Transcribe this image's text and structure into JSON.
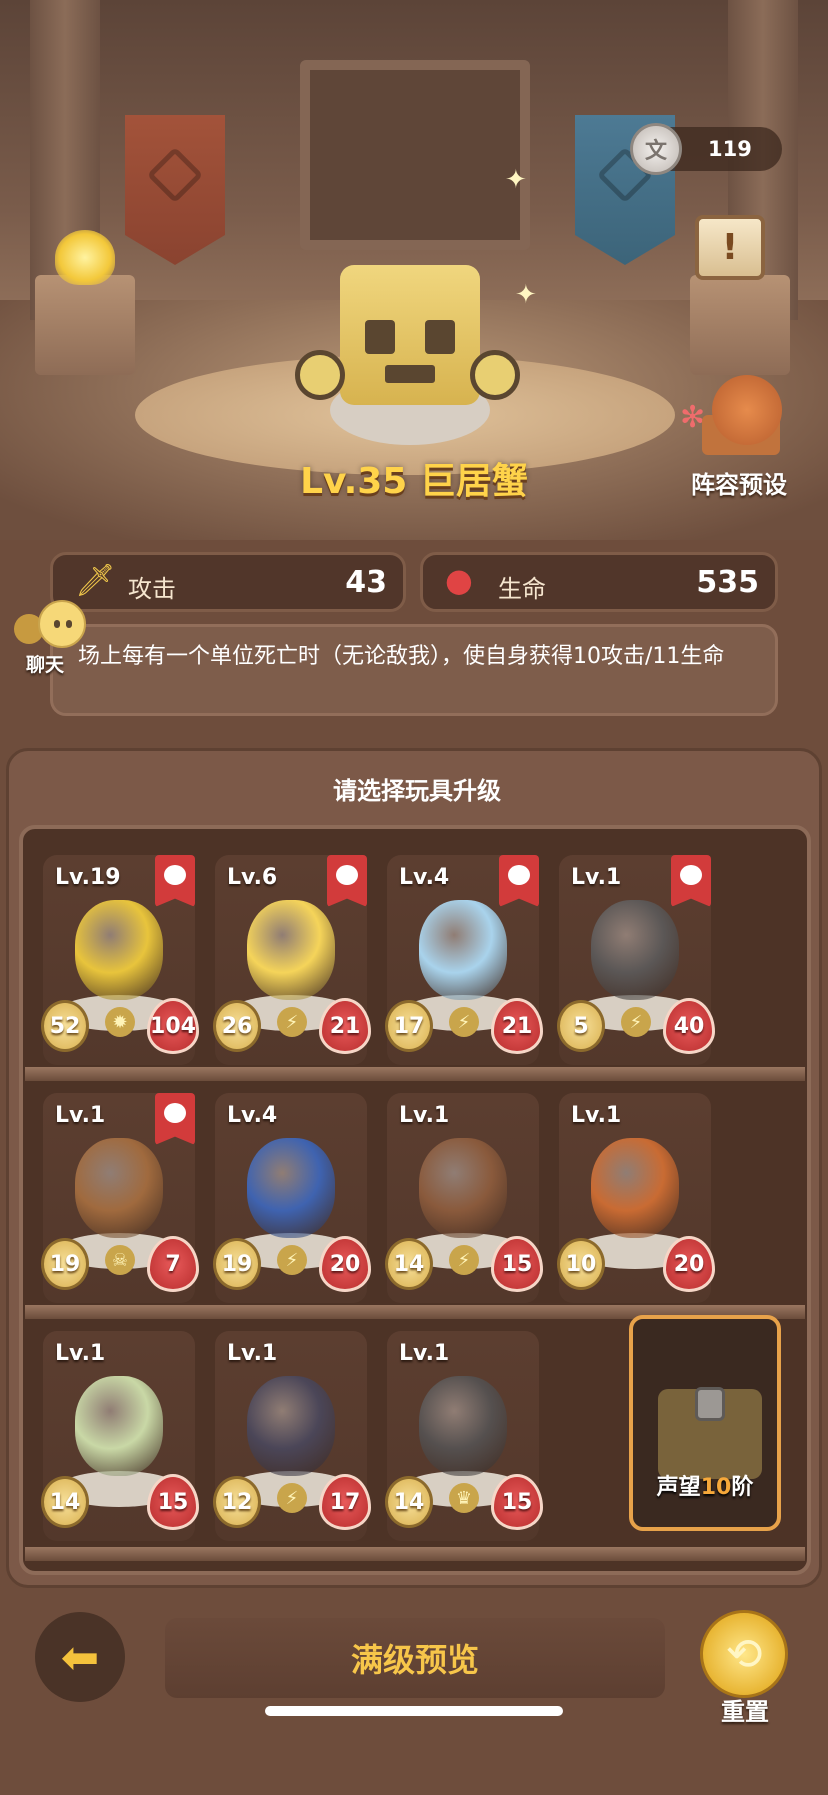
{
  "currency": {
    "icon": "stone-coin-icon",
    "glyph": "文",
    "value": "119"
  },
  "hero": {
    "name": "Lv.35 巨居蟹"
  },
  "lineup_button": {
    "label": "阵容预设"
  },
  "stats": {
    "attack": {
      "label": "攻击",
      "value": "43",
      "icon": "sword-icon"
    },
    "health": {
      "label": "生命",
      "value": "535",
      "icon": "blood-drop-icon"
    }
  },
  "skill_description": "场上每有一个单位死亡时（无论敌我），使自身获得10攻击/11生命",
  "chat": {
    "label": "聊天"
  },
  "panel": {
    "title": "请选择玩具升级"
  },
  "toys": [
    {
      "level": "Lv.19",
      "attack": "52",
      "health": "104",
      "tagged": true,
      "ability": "flame-icon",
      "color": "#e8c43c"
    },
    {
      "level": "Lv.6",
      "attack": "26",
      "health": "21",
      "tagged": true,
      "ability": "lightning-icon",
      "color": "#f5d45a"
    },
    {
      "level": "Lv.4",
      "attack": "17",
      "health": "21",
      "tagged": true,
      "ability": "lightning-icon",
      "color": "#a9d3ec"
    },
    {
      "level": "Lv.1",
      "attack": "5",
      "health": "40",
      "tagged": true,
      "ability": "lightning-icon",
      "color": "#5b5756"
    },
    {
      "level": "Lv.1",
      "attack": "19",
      "health": "7",
      "tagged": true,
      "ability": "skull-icon",
      "color": "#a06a3e"
    },
    {
      "level": "Lv.4",
      "attack": "19",
      "health": "20",
      "tagged": false,
      "ability": "lightning-icon",
      "color": "#3f63b0"
    },
    {
      "level": "Lv.1",
      "attack": "14",
      "health": "15",
      "tagged": false,
      "ability": "lightning-icon",
      "color": "#8a5a3c"
    },
    {
      "level": "Lv.1",
      "attack": "10",
      "health": "20",
      "tagged": false,
      "ability": "none",
      "color": "#c96b33"
    },
    {
      "level": "Lv.1",
      "attack": "14",
      "health": "15",
      "tagged": false,
      "ability": "none",
      "color": "#c9d8a6"
    },
    {
      "level": "Lv.1",
      "attack": "12",
      "health": "17",
      "tagged": false,
      "ability": "lightning-icon",
      "color": "#4b4658"
    },
    {
      "level": "Lv.1",
      "attack": "14",
      "health": "15",
      "tagged": false,
      "ability": "crown-icon",
      "color": "#55504f"
    }
  ],
  "locked_slot": {
    "prefix": "声望",
    "rank": "10",
    "suffix": "阶"
  },
  "footer": {
    "back_icon": "back-arrow-icon",
    "preview_label": "满级预览",
    "reset_label": "重置"
  },
  "colors": {
    "accent": "#ffd34a",
    "tag_red": "#d23b3b",
    "lock_border": "#e7a24a"
  }
}
